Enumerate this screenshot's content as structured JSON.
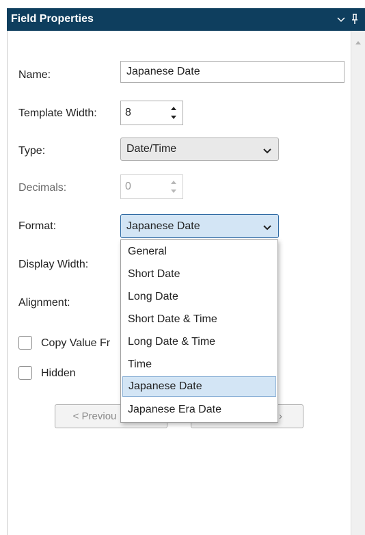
{
  "panel": {
    "title": "Field Properties",
    "icons": {
      "menu": "chevron-down-icon",
      "pin": "pin-icon"
    }
  },
  "form": {
    "name_label": "Name:",
    "name_value": "Japanese Date",
    "template_width_label": "Template Width:",
    "template_width_value": "8",
    "type_label": "Type:",
    "type_value": "Date/Time",
    "decimals_label": "Decimals:",
    "decimals_value": "0",
    "format_label": "Format:",
    "format_value": "Japanese Date",
    "display_width_label": "Display Width:",
    "alignment_label": "Alignment:",
    "copy_value_label": "Copy Value Fr",
    "hidden_label": "Hidden",
    "previous_button": "< Previou",
    "next_button_fragment": "›"
  },
  "format_dropdown": {
    "options": [
      "General",
      "Short Date",
      "Long Date",
      "Short Date & Time",
      "Long Date & Time",
      "Time",
      "Japanese Date",
      "Japanese Era Date"
    ],
    "selected": "Japanese Date"
  },
  "colors": {
    "titlebar": "#0e3e5e",
    "selection": "#d3e5f5",
    "selection_border": "#8ab0d6"
  }
}
